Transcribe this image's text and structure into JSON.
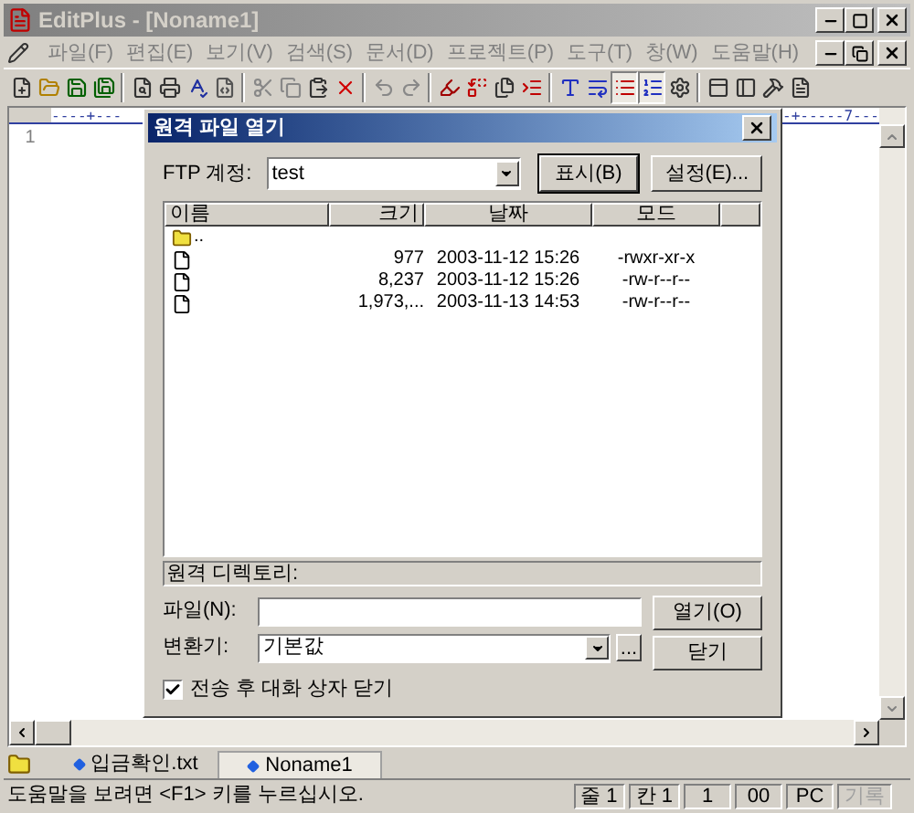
{
  "window": {
    "title": "EditPlus - [Noname1]"
  },
  "menu": [
    "파일(F)",
    "편집(E)",
    "보기(V)",
    "검색(S)",
    "문서(D)",
    "프로젝트(P)",
    "도구(T)",
    "창(W)",
    "도움말(H)"
  ],
  "toolbar": [
    {
      "kind": "new",
      "pressed": false
    },
    {
      "kind": "open",
      "pressed": false
    },
    {
      "kind": "save",
      "pressed": false
    },
    {
      "kind": "save-all",
      "pressed": false
    },
    {
      "kind": "sep"
    },
    {
      "kind": "preview",
      "pressed": false
    },
    {
      "kind": "print",
      "pressed": false
    },
    {
      "kind": "spell",
      "pressed": false
    },
    {
      "kind": "browser",
      "pressed": false
    },
    {
      "kind": "sep"
    },
    {
      "kind": "cut",
      "pressed": false
    },
    {
      "kind": "copy",
      "pressed": false
    },
    {
      "kind": "paste",
      "pressed": false
    },
    {
      "kind": "delete",
      "pressed": false
    },
    {
      "kind": "sep"
    },
    {
      "kind": "undo",
      "pressed": false
    },
    {
      "kind": "redo",
      "pressed": false
    },
    {
      "kind": "sep"
    },
    {
      "kind": "highlight",
      "pressed": false
    },
    {
      "kind": "replace",
      "pressed": false
    },
    {
      "kind": "clip",
      "pressed": false
    },
    {
      "kind": "indent",
      "pressed": false
    },
    {
      "kind": "sep"
    },
    {
      "kind": "font",
      "pressed": false
    },
    {
      "kind": "wrap",
      "pressed": false
    },
    {
      "kind": "lines",
      "pressed": true
    },
    {
      "kind": "numbers",
      "pressed": true
    },
    {
      "kind": "settings",
      "pressed": false
    },
    {
      "kind": "sep"
    },
    {
      "kind": "pane-top",
      "pressed": false
    },
    {
      "kind": "pane-left",
      "pressed": false
    },
    {
      "kind": "tool",
      "pressed": false
    },
    {
      "kind": "file",
      "pressed": false
    }
  ],
  "editor": {
    "ruler_left": "----+---",
    "ruler_right": "-+-----7---",
    "line_numbers": [
      "1"
    ]
  },
  "dialog": {
    "title": "원격 파일 열기",
    "ftp_label": "FTP 계정:",
    "ftp_value": "test",
    "show_button": "표시(B)",
    "settings_button": "설정(E)...",
    "columns": [
      "이름",
      "크기",
      "날짜",
      "모드"
    ],
    "rows": [
      {
        "kind": "folder",
        "name": "..",
        "size": "",
        "date": "",
        "mode": ""
      },
      {
        "kind": "file",
        "name": "",
        "size": "977",
        "date": "2003-11-12 15:26",
        "mode": "-rwxr-xr-x"
      },
      {
        "kind": "file",
        "name": "",
        "size": "8,237",
        "date": "2003-11-12 15:26",
        "mode": "-rw-r--r--"
      },
      {
        "kind": "file",
        "name": "",
        "size": "1,973,...",
        "date": "2003-11-13 14:53",
        "mode": "-rw-r--r--"
      }
    ],
    "remote_dir_label": "원격 디렉토리:",
    "file_label": "파일(N):",
    "open_button": "열기(O)",
    "converter_label": "변환기:",
    "converter_value": "기본값",
    "browse_button": "...",
    "close_button": "닫기",
    "close_after_transfer": {
      "label": "전송 후 대화 상자 닫기",
      "checked": true
    }
  },
  "tabs": [
    {
      "label": "입금확인.txt",
      "selected": false
    },
    {
      "label": "Noname1",
      "selected": true
    }
  ],
  "status_bar": {
    "message": "도움말을 보려면 <F1> 키를 누르십시오.",
    "cells": [
      {
        "text": "줄 1",
        "disabled": false
      },
      {
        "text": "칸 1",
        "disabled": false
      },
      {
        "text": "1",
        "disabled": false
      },
      {
        "text": "00",
        "disabled": false
      },
      {
        "text": "PC",
        "disabled": false
      },
      {
        "text": "기록",
        "disabled": true
      }
    ]
  }
}
